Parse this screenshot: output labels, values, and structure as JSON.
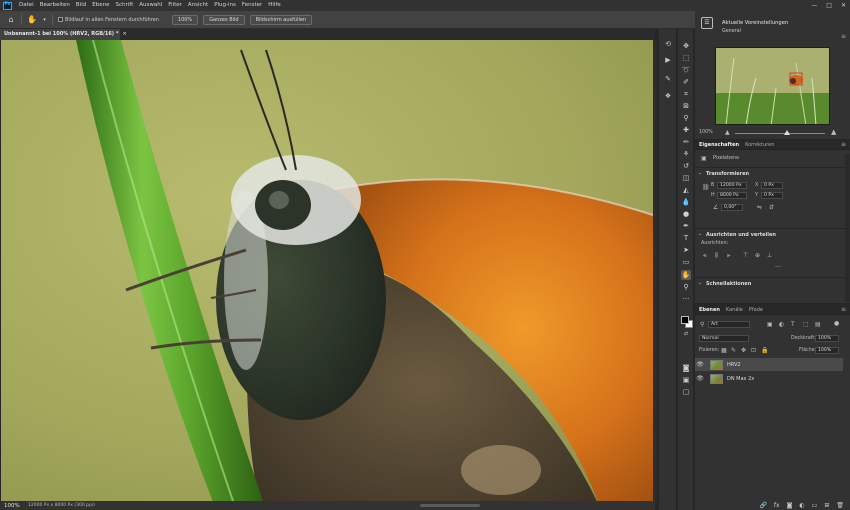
{
  "menu": {
    "logo": "Ps",
    "items": [
      "Datei",
      "Bearbeiten",
      "Bild",
      "Ebene",
      "Schrift",
      "Auswahl",
      "Filter",
      "Ansicht",
      "Plug-ins",
      "Fenster",
      "Hilfe"
    ],
    "window_controls": [
      "—",
      "□",
      "✕"
    ]
  },
  "options": {
    "scroll_all_label": "Bildlauf in allen Fenstern durchführen",
    "zoom_100_label": "100%",
    "fit_label": "Ganzes Bild",
    "fill_label": "Bildschirm ausfüllen"
  },
  "document": {
    "tab_title": "Unbenannt-1 bei 100% (HRV2, RGB/16) *",
    "close": "×"
  },
  "status": {
    "zoom": "100%",
    "info": "12000 Px x 8000 Px (300 ppi)"
  },
  "navigator": {
    "title": "Aktuelle Voreinstellungen",
    "subtitle": "General",
    "zoom": "100%",
    "zoom_position": 0.58
  },
  "properties": {
    "tabs": [
      "Eigenschaften",
      "Korrekturen"
    ],
    "kind": "Pixelebene",
    "transform_label": "Transformieren",
    "w_label": "B",
    "w_value": "12000 Px",
    "h_label": "H",
    "h_value": "8000 Px",
    "x_label": "X",
    "x_value": "0 Px",
    "y_label": "Y",
    "y_value": "0 Px",
    "angle_value": "0,00°",
    "align_label": "Ausrichten und verteilen",
    "align_sub": "Ausrichten:",
    "quick_label": "Schnellaktionen"
  },
  "layers": {
    "tabs": [
      "Ebenen",
      "Kanäle",
      "Pfade"
    ],
    "filter_kind": "Art",
    "blend_mode": "Normal",
    "opacity_label": "Deckkraft:",
    "opacity_value": "100%",
    "lock_label": "Fixieren:",
    "fill_label": "Fläche:",
    "fill_value": "100%",
    "items": [
      {
        "name": "HRV2",
        "selected": true
      },
      {
        "name": "DN Max 2x",
        "selected": false
      }
    ]
  }
}
